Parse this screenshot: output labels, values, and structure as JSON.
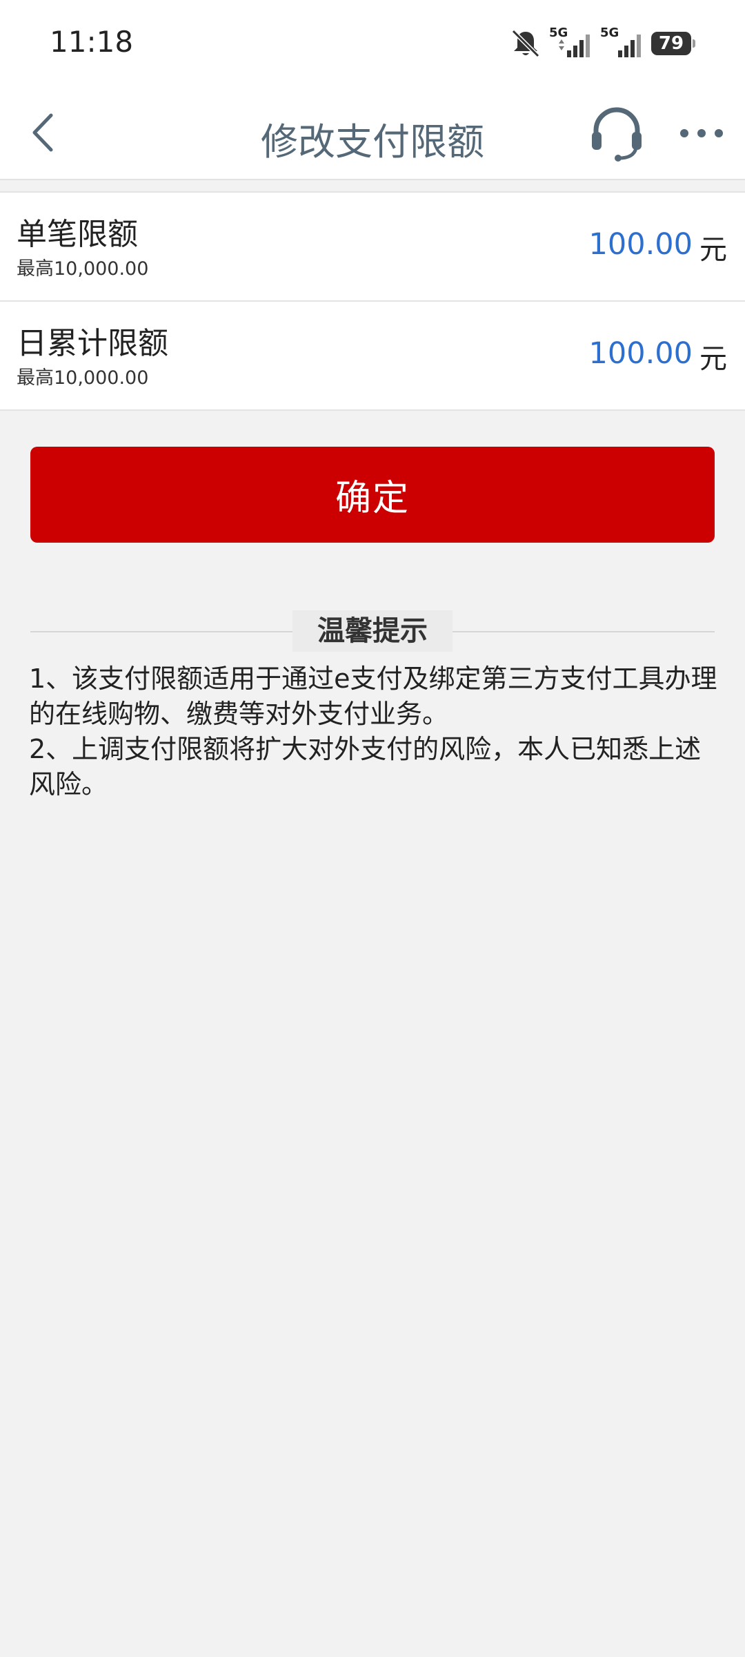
{
  "status_bar": {
    "time": "11:18",
    "network_1": "5G",
    "network_2": "5G",
    "battery": "79",
    "icons": [
      "mute-bell-icon",
      "signal-icon",
      "signal-icon",
      "battery-icon"
    ]
  },
  "header": {
    "title": "修改支付限额",
    "back_icon": "back-chevron-icon",
    "service_icon": "headset-icon",
    "more_icon": "more-dots-icon"
  },
  "limits": [
    {
      "label": "单笔限额",
      "max_text": "最高10,000.00",
      "value": "100.00",
      "unit": "元"
    },
    {
      "label": "日累计限额",
      "max_text": "最高10,000.00",
      "value": "100.00",
      "unit": "元"
    }
  ],
  "confirm_label": "确定",
  "tips": {
    "title": "温馨提示",
    "items": [
      "1、该支付限额适用于通过e支付及绑定第三方支付工具办理的在线购物、缴费等对外支付业务。",
      "2、上调支付限额将扩大对外支付的风险，本人已知悉上述风险。"
    ]
  },
  "colors": {
    "accent_red": "#cc0000",
    "value_blue": "#2c6fcf",
    "title_gray": "#546877",
    "background": "#f2f2f2"
  }
}
